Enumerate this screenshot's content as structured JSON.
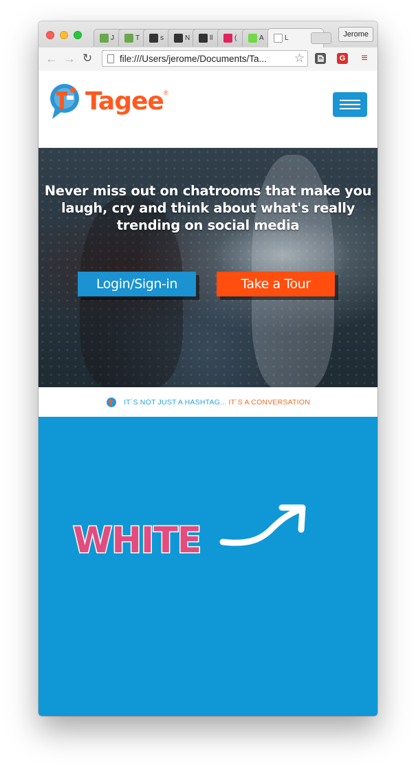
{
  "browser": {
    "profile_name": "Jerome",
    "tabs": [
      {
        "label": "J",
        "icon": "leaf-favicon-icon",
        "color": "#6aa84f"
      },
      {
        "label": "T",
        "icon": "leaf-favicon-icon",
        "color": "#6aa84f"
      },
      {
        "label": "s",
        "icon": "shopping-bag-favicon-icon",
        "color": "#333333"
      },
      {
        "label": "N",
        "icon": "shopping-bag-favicon-icon",
        "color": "#333333"
      },
      {
        "label": "ll",
        "icon": "shopping-bag-favicon-icon",
        "color": "#333333"
      },
      {
        "label": "(",
        "icon": "it-favicon-icon",
        "color": "#e0245e"
      },
      {
        "label": "A",
        "icon": "upwork-favicon-icon",
        "color": "#6fda44"
      },
      {
        "label": "L",
        "icon": "blank-page-icon",
        "color": "#ffffff",
        "active": true
      }
    ],
    "tab_close_glyph": "×",
    "url": "file:///Users/jerome/Documents/Ta...",
    "extensions": [
      {
        "icon": "evernote-icon",
        "text": "",
        "color": "#555555"
      },
      {
        "icon": "grammarly-icon",
        "text": "G",
        "color": "#d9302c"
      },
      {
        "icon": "menu-icon",
        "text": "≡",
        "color": "#c0392b"
      }
    ]
  },
  "site": {
    "logo_text": "Tagee",
    "logo_reg": "®",
    "hero": {
      "headline": "Never miss out on chatrooms that make you laugh, cry and think about what's really trending on social media",
      "login_label": "Login/Sign-in",
      "tour_label": "Take a Tour"
    },
    "tagline": {
      "part1": "IT´S NOT JUST A HASHTAG...",
      "part2": "IT´S A CONVERSATION"
    },
    "annotation": {
      "word": "WHITE"
    }
  },
  "colors": {
    "brand_orange": "#ff5a1f",
    "brand_blue": "#1a95d6",
    "section_blue": "#0f97d6",
    "annotation_pink": "#e34d7e"
  }
}
